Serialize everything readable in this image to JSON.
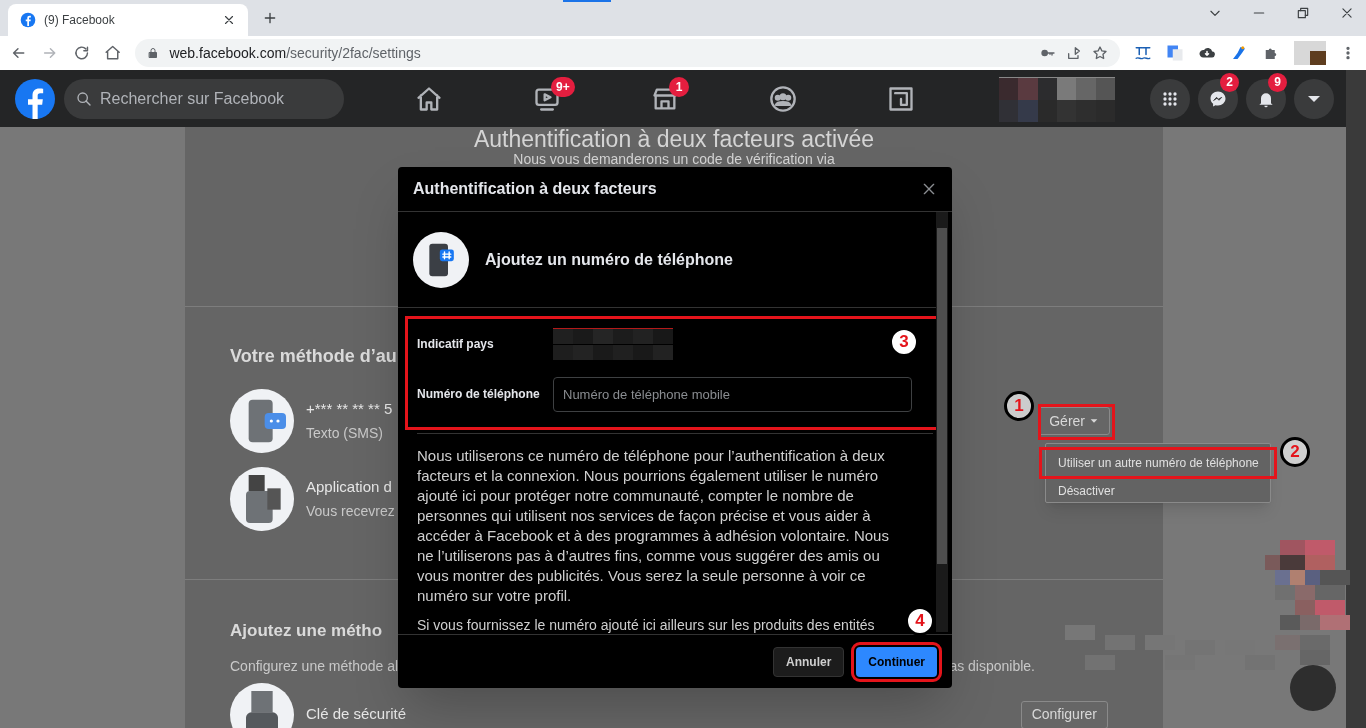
{
  "browser": {
    "tabs": [
      {
        "title": "(9) Facebook",
        "selected": true
      }
    ],
    "url_host": "web.facebook.com",
    "url_path": "/security/2fac/settings"
  },
  "fb_header": {
    "search_placeholder": "Rechercher sur Facebook",
    "nav": [
      {
        "kind": "home"
      },
      {
        "kind": "watch",
        "badge": "9+"
      },
      {
        "kind": "marketplace",
        "badge": "1"
      },
      {
        "kind": "groups"
      },
      {
        "kind": "gaming"
      }
    ],
    "actions": [
      {
        "kind": "menu"
      },
      {
        "kind": "messenger",
        "badge": "2"
      },
      {
        "kind": "notifications",
        "badge": "9"
      },
      {
        "kind": "account"
      }
    ]
  },
  "page": {
    "heading": "Authentification à deux facteurs activée",
    "subheading": "Nous vous demanderons un code de vérification via",
    "methods_title": "Votre méthode d’au",
    "methods": [
      {
        "kind": "sms",
        "line1": "+*** ** ** ** 5",
        "line2": "Texto (SMS)",
        "button": "Gérer"
      },
      {
        "kind": "app",
        "line1": "Application d",
        "line2": "Vous recevrez"
      }
    ],
    "add_title": "Ajoutez une métho",
    "add_desc_left": "Configurez une méthode al",
    "add_desc_right": "as disponible.",
    "add_methods": [
      {
        "kind": "key",
        "line1": "Clé de sécurité",
        "button": "Configurer"
      }
    ]
  },
  "dropdown": {
    "items": [
      {
        "label": "Utiliser un autre numéro de téléphone",
        "highlighted": true
      },
      {
        "label": "Désactiver",
        "highlighted": false
      }
    ]
  },
  "modal": {
    "title": "Authentification à deux facteurs",
    "section_title": "Ajoutez un numéro de téléphone",
    "fields": [
      {
        "kind": "blurred",
        "label": "Indicatif pays"
      },
      {
        "kind": "input",
        "label": "Numéro de téléphone",
        "placeholder": "Numéro de téléphone mobile"
      }
    ],
    "paragraphs": [
      "Nous utiliserons ce numéro de téléphone pour l’authentification à deux facteurs et la connexion. Nous pourrions également utiliser le numéro ajouté ici pour protéger notre communauté, compter le nombre de personnes qui utilisent nos services de façon précise et vous aider à accéder à Facebook et à des programmes à adhésion volontaire. Nous ne l’utiliserons pas à d’autres fins, comme vous suggérer des amis ou vous montrer des publicités. Vous serez la seule personne à voir ce numéro sur votre profil.",
      "Si vous fournissez le numéro ajouté ici ailleurs sur les produits des entités"
    ],
    "buttons": [
      {
        "label": "Annuler",
        "primary": false
      },
      {
        "label": "Continuer",
        "primary": true
      }
    ]
  },
  "annotations": [
    {
      "number": "1",
      "kind": "ring"
    },
    {
      "number": "2",
      "kind": "ring"
    },
    {
      "number": "3",
      "kind": "badge"
    },
    {
      "number": "4",
      "kind": "badge"
    }
  ]
}
